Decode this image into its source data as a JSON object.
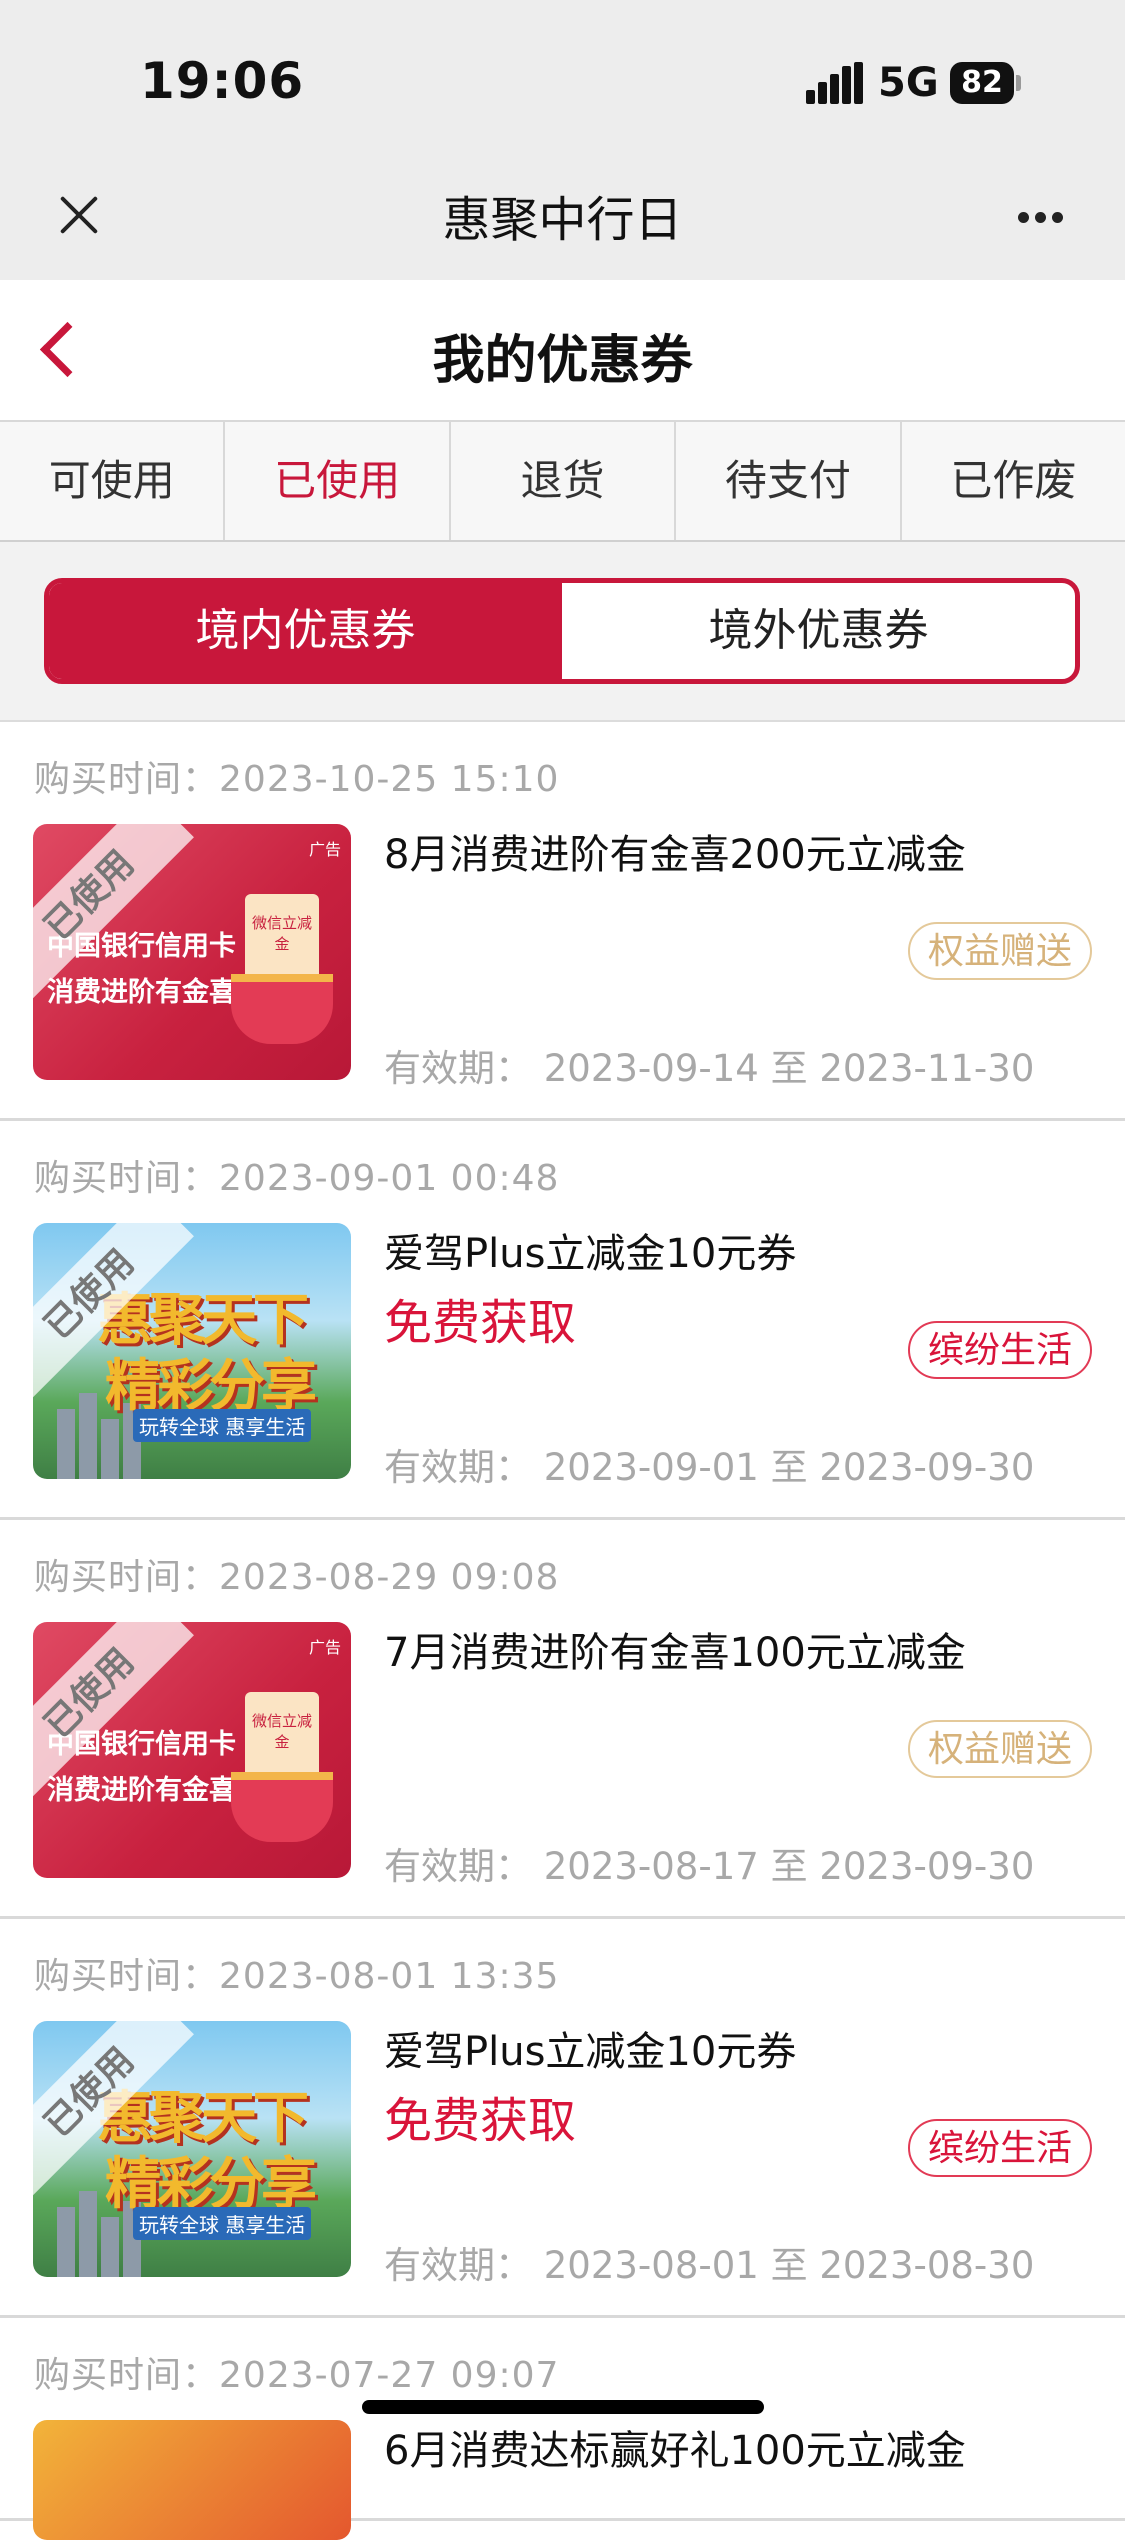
{
  "status_bar": {
    "time": "19:06",
    "network": "5G",
    "battery": "82"
  },
  "titlebar": {
    "title": "惠聚中行日"
  },
  "header": {
    "title": "我的优惠券"
  },
  "tabs": [
    {
      "label": "可使用",
      "active": false
    },
    {
      "label": "已使用",
      "active": true
    },
    {
      "label": "退货",
      "active": false
    },
    {
      "label": "待支付",
      "active": false
    },
    {
      "label": "已作废",
      "active": false
    }
  ],
  "segment": {
    "domestic": "境内优惠券",
    "overseas": "境外优惠券",
    "selected": "domestic"
  },
  "labels": {
    "buy_prefix": "购买时间：",
    "valid_prefix": "有效期：",
    "to": "至",
    "used": "已使用",
    "free": "免费获取"
  },
  "colors": {
    "accent": "#c8173b",
    "gold_badge": "#d6b27a",
    "red_badge": "#d9143a"
  },
  "thumb_text": {
    "red_line1": "中国银行信用卡",
    "red_line2": "消费进阶有金喜",
    "red_ad": "广告",
    "red_card": "微信立减金",
    "scene_title1": "惠聚天下",
    "scene_title2": "精彩分享",
    "scene_sub": "玩转全球 惠享生活"
  },
  "coupons": [
    {
      "buy_time": "2023-10-25 15:10",
      "name": "8月消费进阶有金喜200元立减金",
      "badge": "权益赠送",
      "valid_from": "2023-09-14",
      "valid_to": "2023-11-30",
      "thumb": "red",
      "badge_style": "gold"
    },
    {
      "buy_time": "2023-09-01 00:48",
      "name": "爱驾Plus立减金10元券",
      "badge": "缤纷生活",
      "valid_from": "2023-09-01",
      "valid_to": "2023-09-30",
      "thumb": "scene",
      "badge_style": "red"
    },
    {
      "buy_time": "2023-08-29 09:08",
      "name": "7月消费进阶有金喜100元立减金",
      "badge": "权益赠送",
      "valid_from": "2023-08-17",
      "valid_to": "2023-09-30",
      "thumb": "red",
      "badge_style": "gold"
    },
    {
      "buy_time": "2023-08-01 13:35",
      "name": "爱驾Plus立减金10元券",
      "badge": "缤纷生活",
      "valid_from": "2023-08-01",
      "valid_to": "2023-08-30",
      "thumb": "scene",
      "badge_style": "red"
    },
    {
      "buy_time": "2023-07-27 09:07",
      "name": "6月消费达标赢好礼100元立减金"
    }
  ]
}
